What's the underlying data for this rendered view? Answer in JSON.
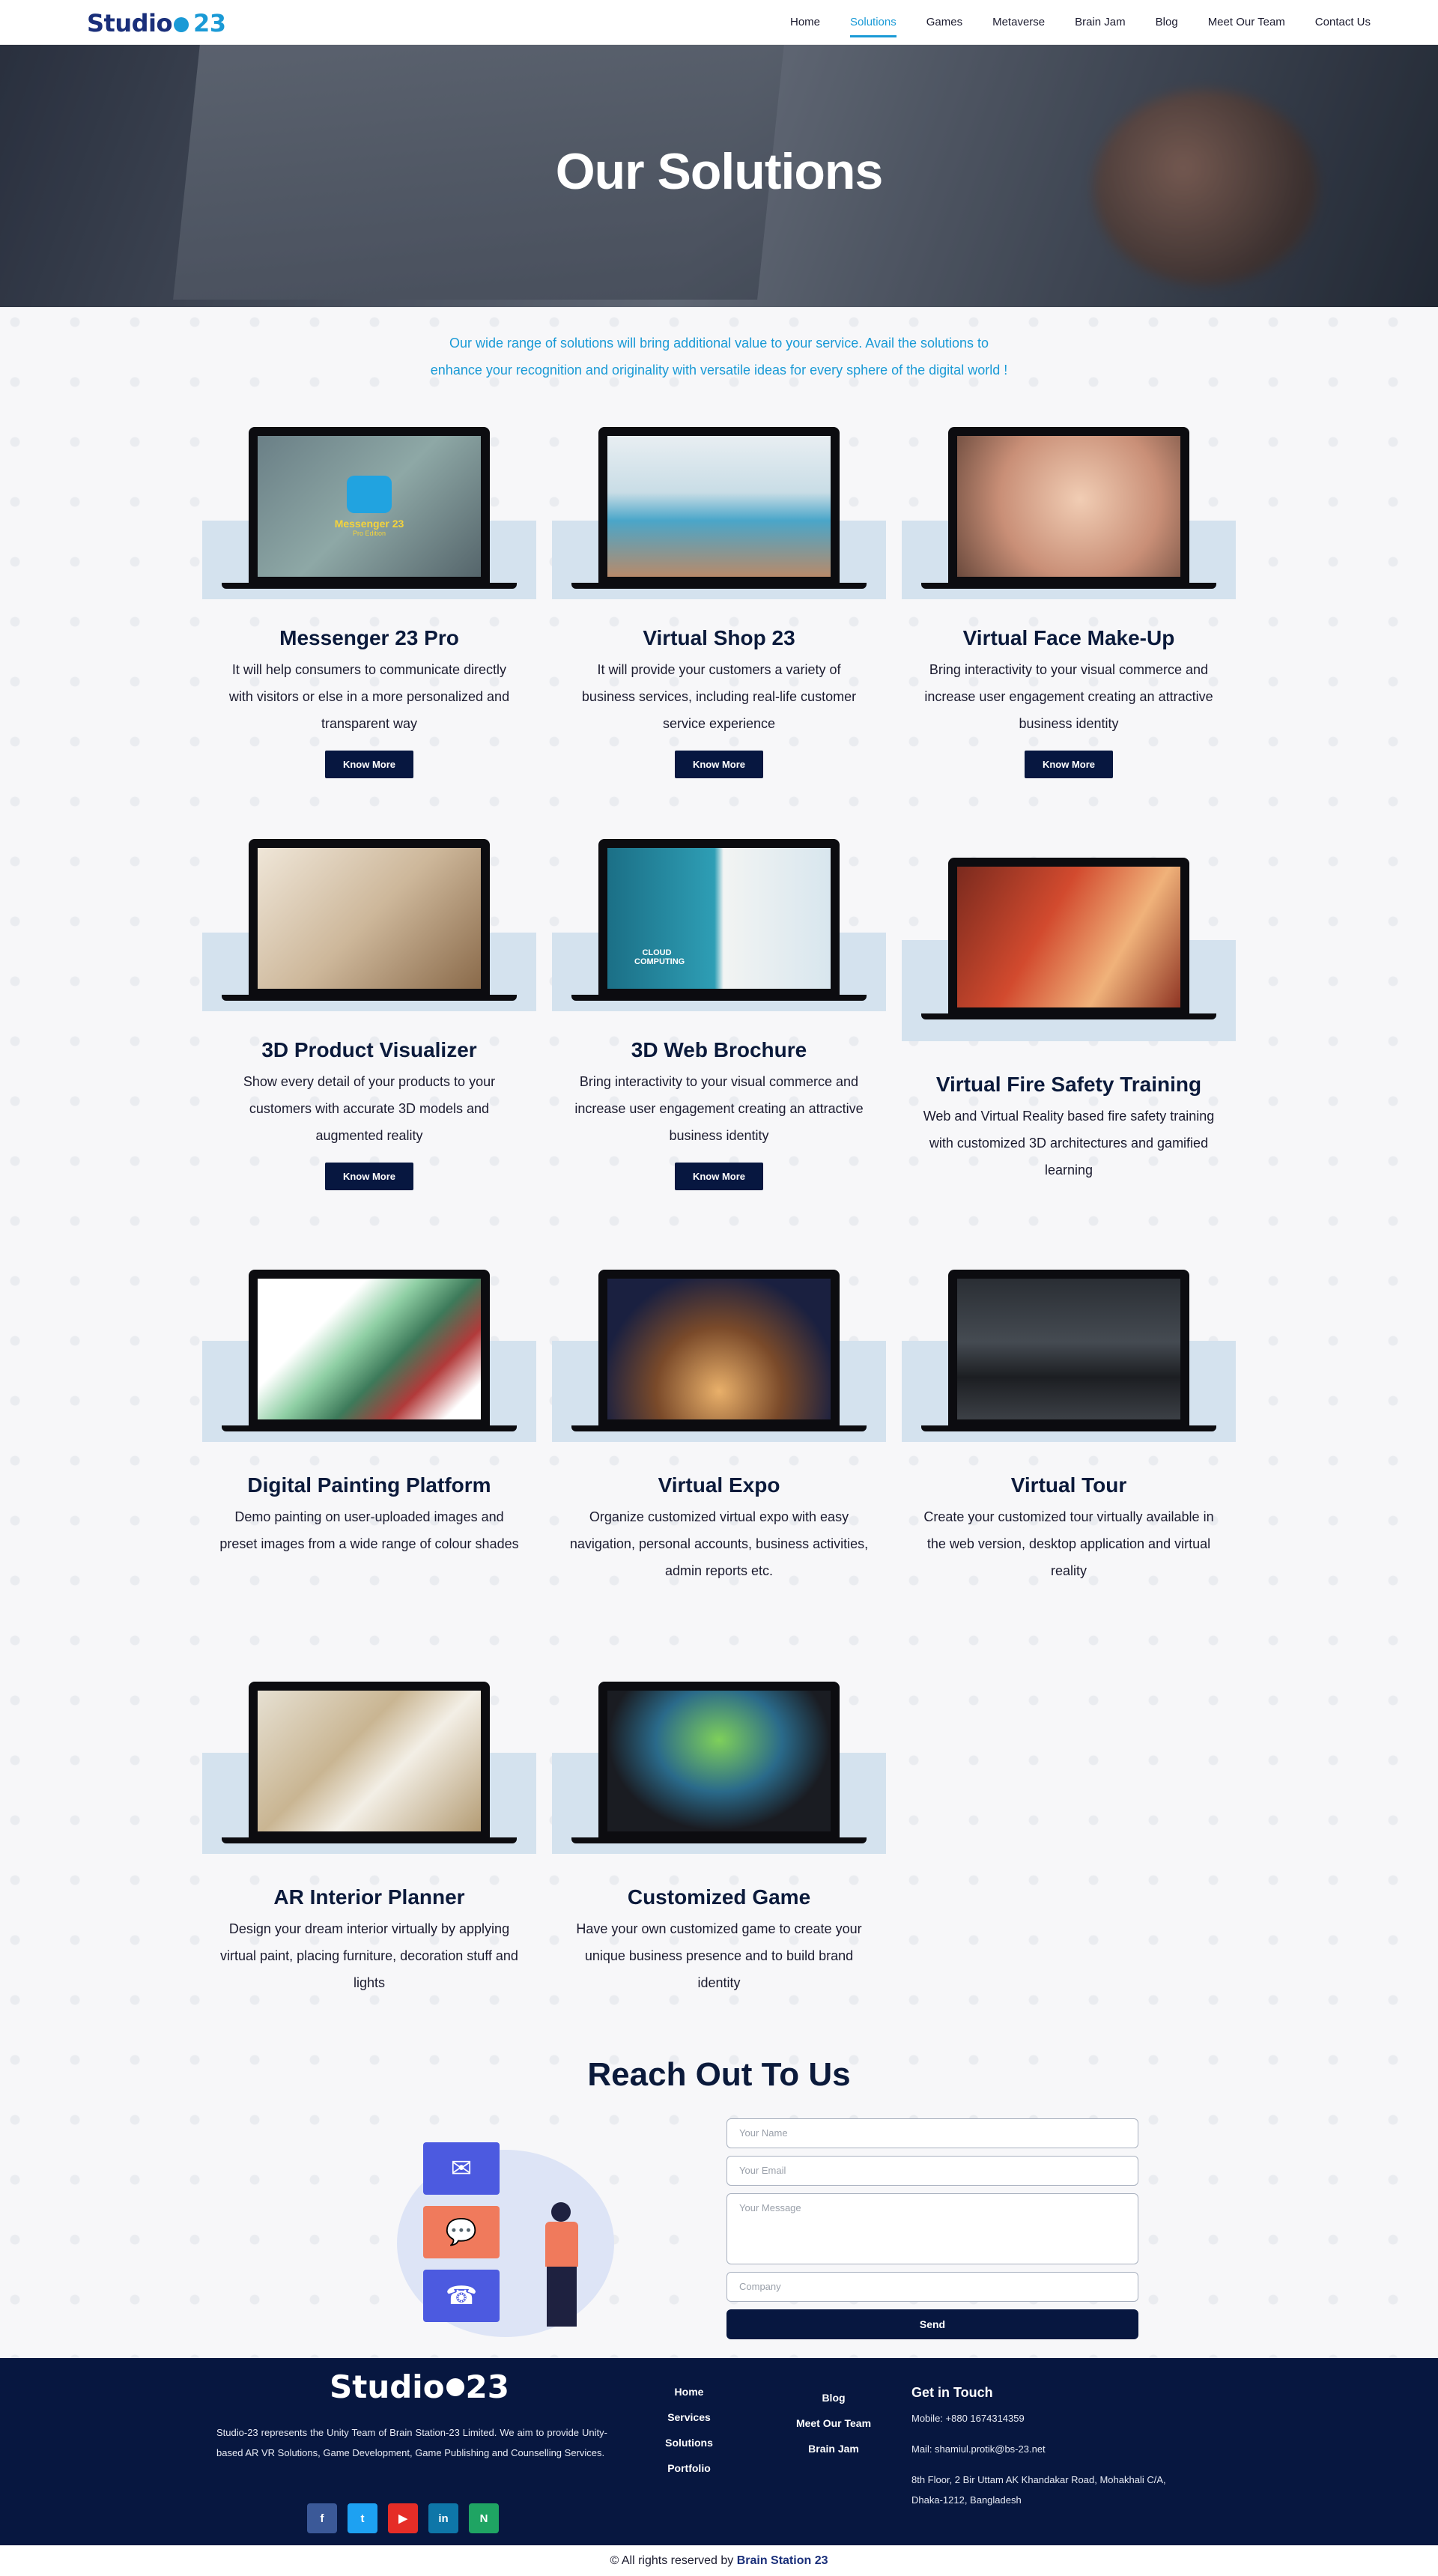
{
  "nav": {
    "logo_text": "Studio",
    "logo_num": "23",
    "links": [
      "Home",
      "Solutions",
      "Games",
      "Metaverse",
      "Brain Jam",
      "Blog",
      "Meet Our Team",
      "Contact Us"
    ],
    "active": "Solutions"
  },
  "hero": {
    "title": "Our Solutions"
  },
  "intro": {
    "line1": "Our wide range of solutions will bring additional value to your service. Avail the solutions to",
    "line2": "enhance your recognition and originality with versatile ideas for every sphere of the digital world !"
  },
  "cards": [
    {
      "title": "Messenger 23 Pro",
      "desc": "It will help consumers to communicate directly with visitors or else in a more personalized and transparent way",
      "button": "Know More",
      "screen_text": "Messenger 23",
      "screen_sub": "Pro Edition"
    },
    {
      "title": "Virtual Shop 23",
      "desc": "It will provide your customers a variety of business services, including real-life customer service experience",
      "button": "Know More"
    },
    {
      "title": "Virtual Face Make-Up",
      "desc": "Bring interactivity to your visual commerce and increase user engagement creating an attractive business identity",
      "button": "Know More"
    },
    {
      "title": "3D Product Visualizer",
      "desc": "Show every detail of your products to your customers with accurate 3D models and augmented reality",
      "button": "Know More"
    },
    {
      "title": "3D Web Brochure",
      "desc": "Bring interactivity to your visual commerce and increase user engagement creating an attractive business identity",
      "button": "Know More",
      "screen_text": "CLOUD COMPUTING"
    },
    {
      "title": "Virtual Fire Safety Training",
      "desc": "Web and Virtual Reality based fire safety training with customized 3D architectures and gamified learning"
    },
    {
      "title": "Digital Painting Platform",
      "desc": "Demo painting on user-uploaded images and preset images from a wide range of colour shades"
    },
    {
      "title": "Virtual Expo",
      "desc": "Organize customized virtual expo with easy navigation, personal accounts, business activities, admin reports etc."
    },
    {
      "title": "Virtual Tour",
      "desc": "Create your customized tour virtually available in the web version, desktop application and virtual reality"
    },
    {
      "title": "AR Interior Planner",
      "desc": "Design your dream interior virtually by applying virtual paint, placing furniture, decoration stuff and lights"
    },
    {
      "title": "Customized Game",
      "desc": "Have your own customized game to create your unique business presence and to build brand identity"
    }
  ],
  "contact": {
    "title": "Reach Out To Us",
    "name_placeholder": "Your Name",
    "email_placeholder": "Your Email",
    "message_placeholder": "Your Message",
    "company_placeholder": "Company",
    "send": "Send"
  },
  "footer": {
    "logo_text": "Studio",
    "logo_num": "23",
    "about": "Studio-23 represents the Unity Team of Brain Station-23 Limited. We aim to provide Unity-based AR VR Solutions, Game Development, Game Publishing and Counselling Services.",
    "socials": [
      "f",
      "t",
      "▶",
      "in",
      "N"
    ],
    "col1": [
      "Home",
      "Services",
      "Solutions",
      "Portfolio"
    ],
    "col2": [
      "Blog",
      "Meet Our Team",
      "Brain Jam"
    ],
    "touch_title": "Get in Touch",
    "mobile": "Mobile: +880 1674314359",
    "mail": "Mail: shamiul.protik@bs-23.net",
    "address1": "8th Floor, 2 Bir Uttam AK Khandakar Road, Mohakhali C/A,",
    "address2": "Dhaka-1212, Bangladesh"
  },
  "copyright": {
    "prefix": "© All rights reserved by",
    "brand": "Brain Station 23"
  },
  "colors": {
    "accent": "#1a9ad6",
    "navy": "#071740",
    "band": "#d4e2ee"
  }
}
